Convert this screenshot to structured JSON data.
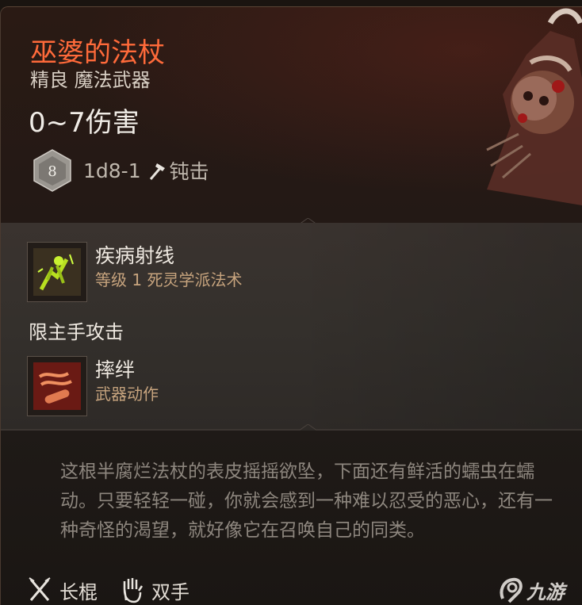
{
  "item": {
    "name": "巫婆的法杖",
    "subtitle": "精良 魔法武器",
    "damage": "0~7伤害",
    "die_face": "8",
    "dice_formula": "1d8-1",
    "damage_type": "钝击"
  },
  "abilities": [
    {
      "name": "疾病射线",
      "detail": "等级 1 死灵学派法术",
      "icon": "sickness-ray-icon"
    },
    {
      "name": "摔绊",
      "detail": "武器动作",
      "icon": "topple-icon"
    }
  ],
  "restriction": "限主手攻击",
  "description": "这根半腐烂法杖的表皮摇摇欲坠，下面还有鲜活的蠕虫在蠕动。只要轻轻一碰，你就会感到一种难以忍受的恶心，还有一种奇怪的渴望，就好像它在召唤自己的同类。",
  "footer": {
    "weapon_type": "长棍",
    "handedness": "双手"
  },
  "watermark": "九游",
  "colors": {
    "title": "#ff6a3a",
    "detail": "#c7a47e",
    "description": "#8d867e"
  }
}
